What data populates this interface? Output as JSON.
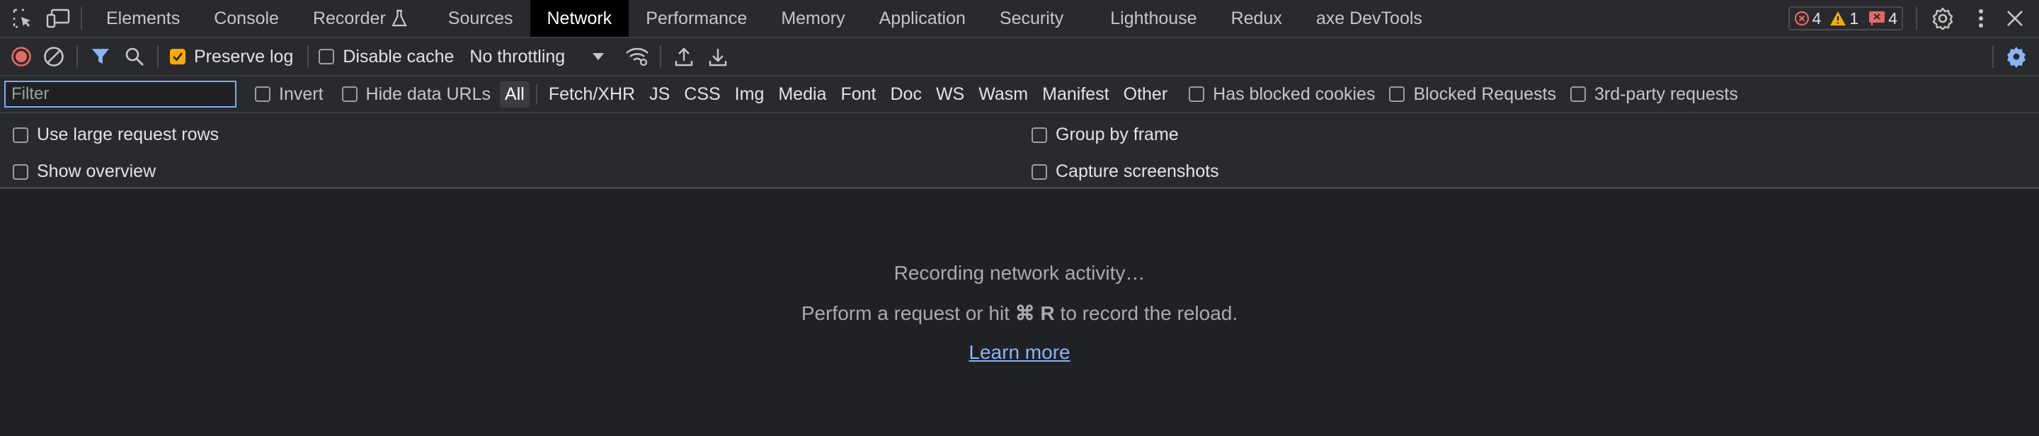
{
  "tabs": [
    {
      "label": "Elements",
      "active": false
    },
    {
      "label": "Console",
      "active": false
    },
    {
      "label": "Recorder",
      "active": false
    },
    {
      "label": "Sources",
      "active": false
    },
    {
      "label": "Network",
      "active": true
    },
    {
      "label": "Performance",
      "active": false
    },
    {
      "label": "Memory",
      "active": false
    },
    {
      "label": "Application",
      "active": false
    },
    {
      "label": "Security",
      "active": false
    },
    {
      "label": "Lighthouse",
      "active": false
    },
    {
      "label": "Redux",
      "active": false
    },
    {
      "label": "axe DevTools",
      "active": false
    }
  ],
  "counters": {
    "errors": "4",
    "warnings": "1",
    "issues": "4"
  },
  "toolbar": {
    "preserve_log": "Preserve log",
    "preserve_log_checked": true,
    "disable_cache": "Disable cache",
    "disable_cache_checked": false,
    "throttling": "No throttling"
  },
  "filter": {
    "placeholder": "Filter",
    "invert": "Invert",
    "hide_data_urls": "Hide data URLs",
    "types": [
      "All",
      "Fetch/XHR",
      "JS",
      "CSS",
      "Img",
      "Media",
      "Font",
      "Doc",
      "WS",
      "Wasm",
      "Manifest",
      "Other"
    ],
    "active_type": "All",
    "has_blocked_cookies": "Has blocked cookies",
    "blocked_requests": "Blocked Requests",
    "third_party": "3rd-party requests"
  },
  "settings": {
    "large_rows": "Use large request rows",
    "show_overview": "Show overview",
    "group_by_frame": "Group by frame",
    "capture_screenshots": "Capture screenshots"
  },
  "empty": {
    "recording": "Recording network activity…",
    "hint_before": "Perform a request or hit ",
    "hint_key": "⌘ R",
    "hint_after": " to record the reload.",
    "learn_more": "Learn more"
  },
  "colors": {
    "accent": "#8ab4f8",
    "record": "#e46962",
    "checked": "#f9ab00",
    "error": "#e46962",
    "warning": "#f9ab00",
    "issue": "#e46962"
  }
}
